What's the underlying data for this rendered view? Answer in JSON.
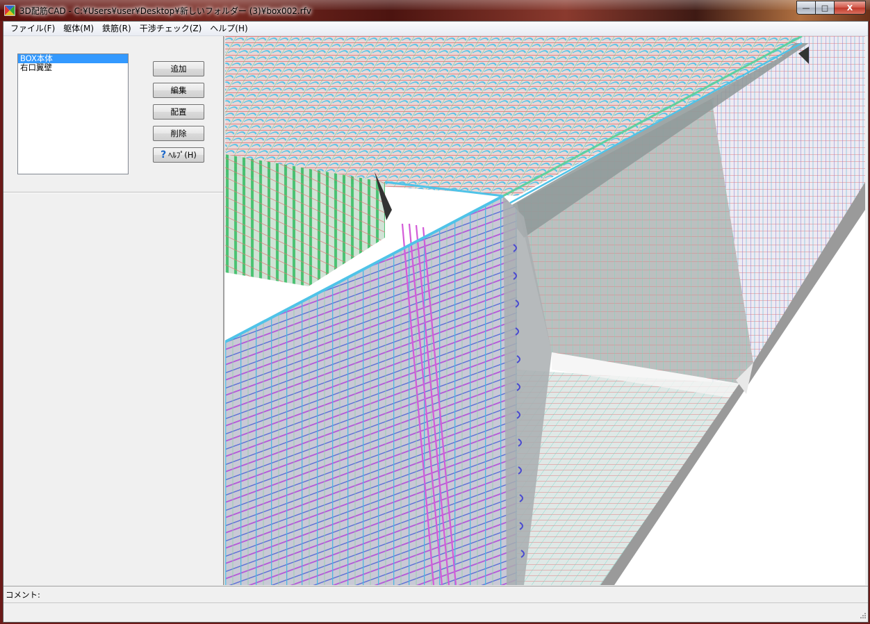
{
  "window": {
    "title": "3D配筋CAD - C:¥Users¥user¥Desktop¥新しいフォルダー (3)¥box002.rfv",
    "minimize_glyph": "—",
    "maximize_glyph": "□",
    "close_glyph": "X"
  },
  "menu": {
    "items": [
      "ファイル(F)",
      "躯体(M)",
      "鉄筋(R)",
      "干渉チェック(Z)",
      "ヘルプ(H)"
    ]
  },
  "structure_list": {
    "items": [
      "BOX本体",
      "右口翼壁"
    ],
    "selected_index": 0
  },
  "buttons": {
    "add": "追加",
    "edit": "編集",
    "place": "配置",
    "delete": "削除",
    "help": "ﾍﾙﾌﾟ(H)",
    "help_icon": "?"
  },
  "comment": {
    "label": "コメント:"
  },
  "colors": {
    "selection": "#3399ff",
    "rebar_cyan": "#4fc3e8",
    "rebar_blue": "#5b6fd6",
    "rebar_magenta": "#d35bd8",
    "rebar_green": "#5fd08a",
    "rebar_red": "#e06060",
    "concrete": "#9a9a9a"
  }
}
